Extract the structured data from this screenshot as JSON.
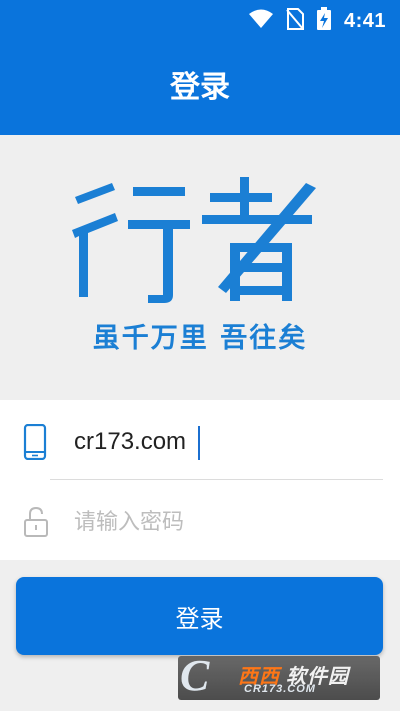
{
  "status_bar": {
    "time": "4:41",
    "icons": [
      "wifi-icon",
      "no-sim-icon",
      "battery-charging-icon"
    ]
  },
  "header": {
    "title": "登录"
  },
  "brand": {
    "logo_text": "行者",
    "slogan": "虽千万里 吾往矣",
    "color": "#1b7fd4"
  },
  "form": {
    "phone": {
      "value": "cr173.com",
      "icon": "phone-icon"
    },
    "password": {
      "placeholder": "请输入密码",
      "icon": "lock-icon"
    }
  },
  "actions": {
    "login_label": "登录"
  },
  "watermark": {
    "brand_mark": "C",
    "name_part1": "西西",
    "name_part2": "软件园",
    "url": "CR173.COM"
  },
  "colors": {
    "primary": "#0a74dc",
    "background": "#efefef"
  }
}
